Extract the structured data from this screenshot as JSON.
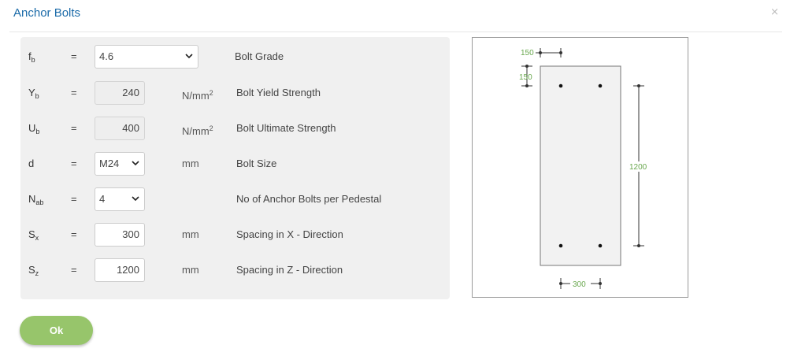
{
  "dialog": {
    "title": "Anchor Bolts",
    "close_glyph": "×",
    "ok_label": "Ok"
  },
  "fields": [
    {
      "symbol": "f",
      "sub": "b",
      "eq": "=",
      "kind": "select",
      "value": "4.6",
      "unit": "",
      "unit_sup": "",
      "desc": "Bolt Grade"
    },
    {
      "symbol": "Y",
      "sub": "b",
      "eq": "=",
      "kind": "readonly",
      "value": "240",
      "unit": "N/mm",
      "unit_sup": "2",
      "desc": "Bolt Yield Strength"
    },
    {
      "symbol": "U",
      "sub": "b",
      "eq": "=",
      "kind": "readonly",
      "value": "400",
      "unit": "N/mm",
      "unit_sup": "2",
      "desc": "Bolt Ultimate Strength"
    },
    {
      "symbol": "d",
      "sub": "",
      "eq": "=",
      "kind": "select",
      "value": "M24",
      "unit": "mm",
      "unit_sup": "",
      "desc": "Bolt Size"
    },
    {
      "symbol": "N",
      "sub": "ab",
      "eq": "=",
      "kind": "select",
      "value": "4",
      "unit": "",
      "unit_sup": "",
      "desc": "No of Anchor Bolts per Pedestal"
    },
    {
      "symbol": "S",
      "sub": "x",
      "eq": "=",
      "kind": "input",
      "value": "300",
      "unit": "mm",
      "unit_sup": "",
      "desc": "Spacing in X - Direction"
    },
    {
      "symbol": "S",
      "sub": "z",
      "eq": "=",
      "kind": "input",
      "value": "1200",
      "unit": "mm",
      "unit_sup": "",
      "desc": "Spacing in Z - Direction"
    }
  ],
  "diagram": {
    "edge_x_label": "150",
    "edge_z_label": "150",
    "spacing_z_label": "1200",
    "spacing_x_label": "300",
    "dimension_color": "#6aa84f"
  },
  "colors": {
    "title": "#1a6aa8",
    "ok_button": "#97c56b",
    "panel": "#f0f0f0"
  }
}
